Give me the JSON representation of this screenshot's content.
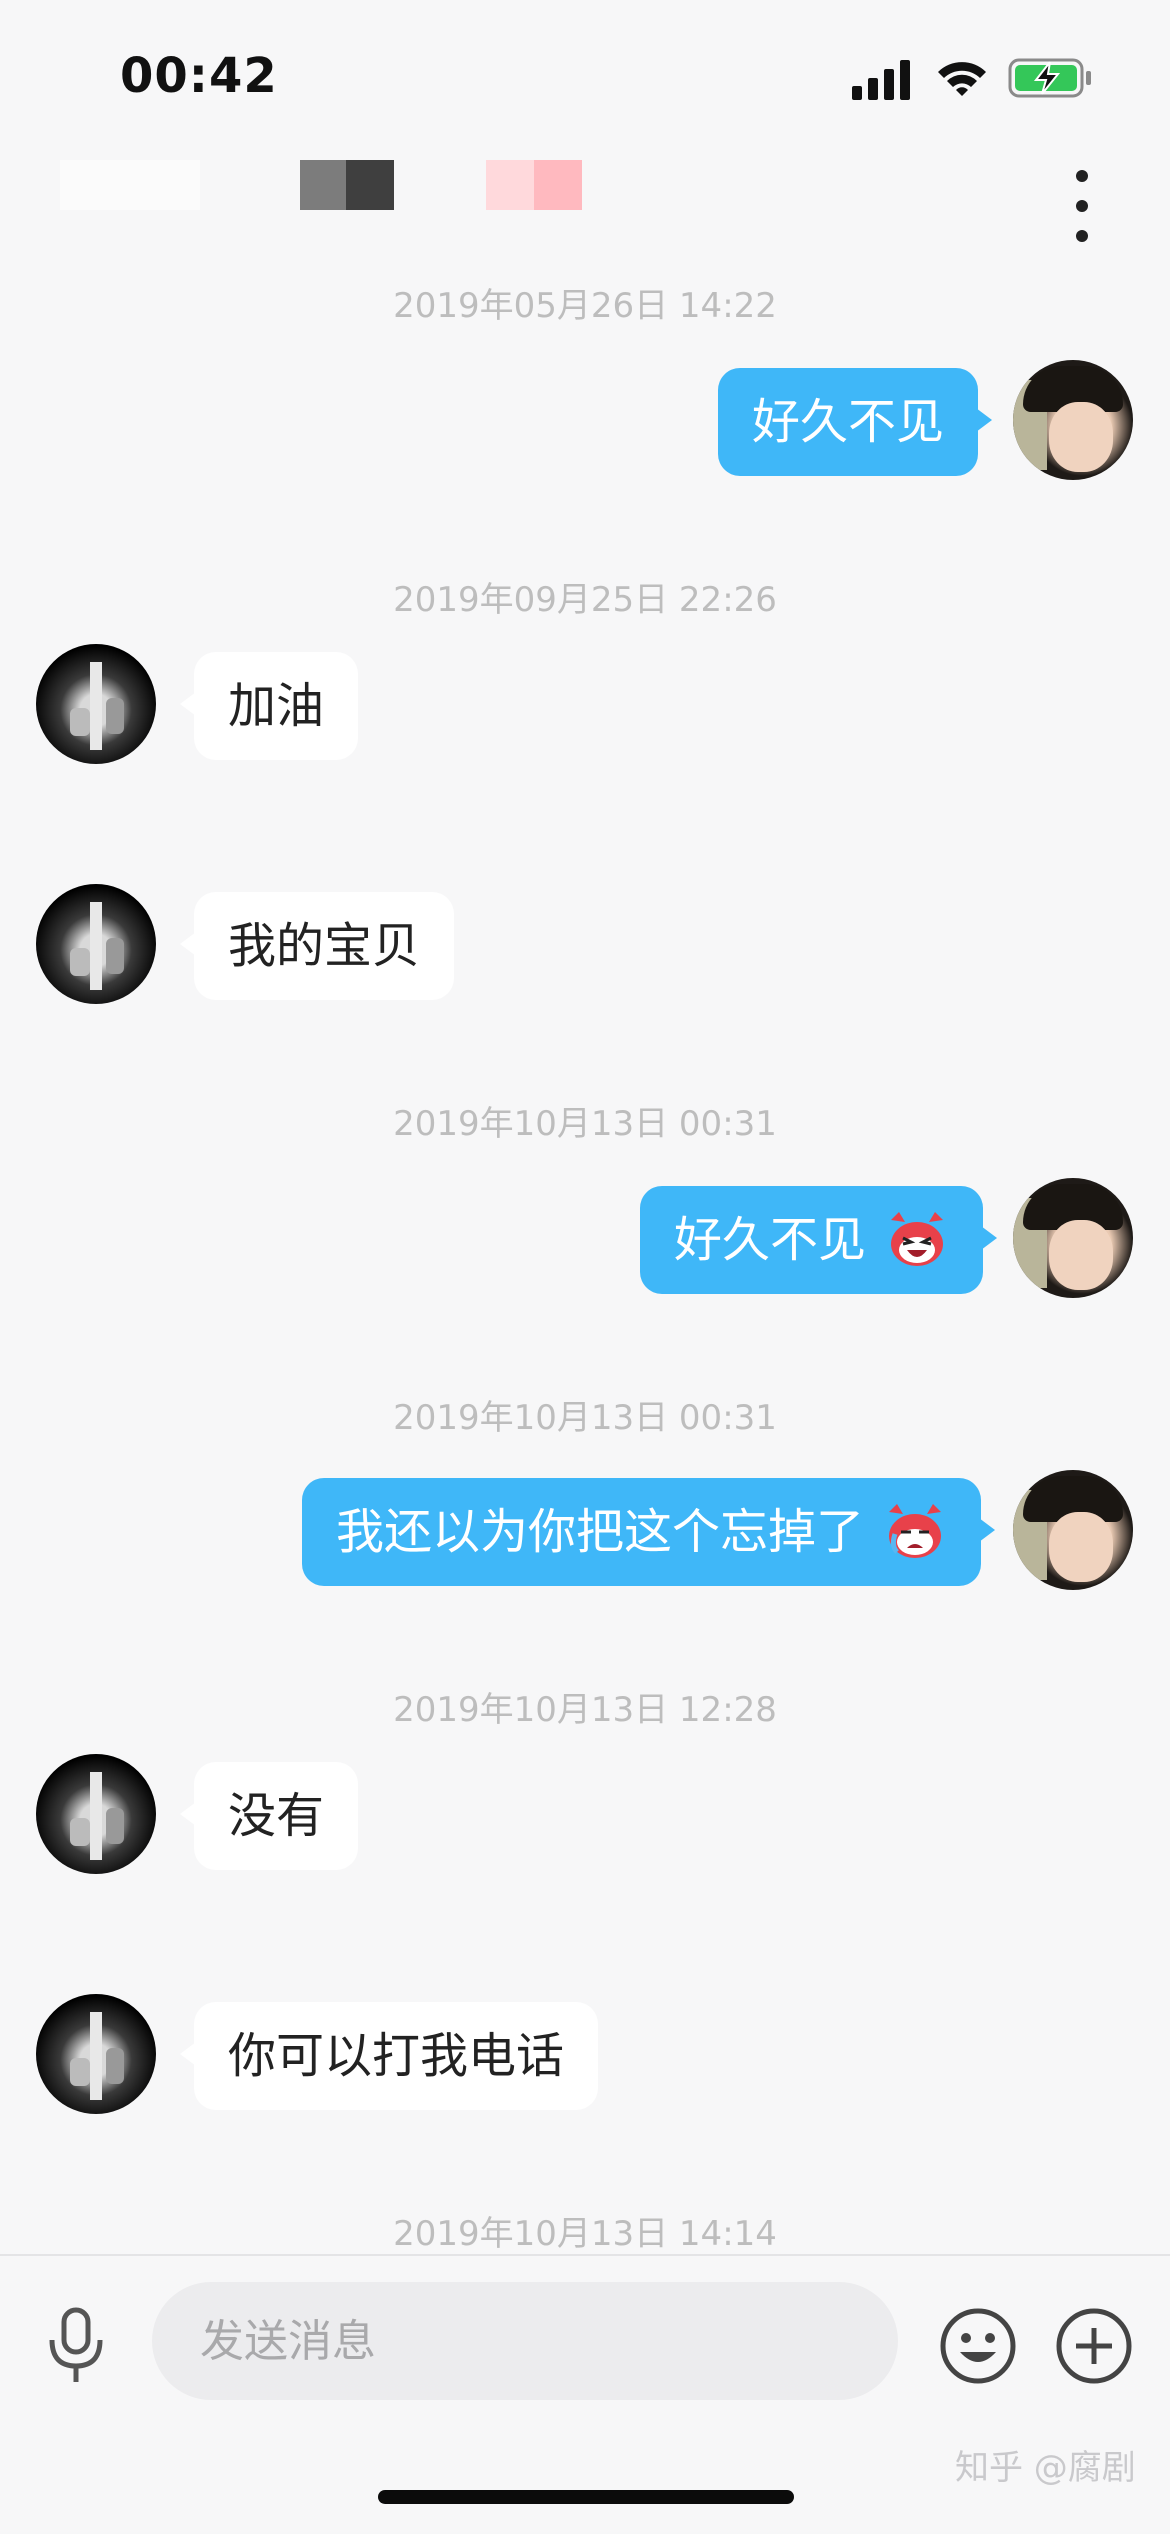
{
  "status_bar": {
    "time": "00:42"
  },
  "conversation": {
    "items": [
      {
        "type": "timestamp",
        "text": "2019年05月26日 14:22"
      },
      {
        "type": "message",
        "side": "out",
        "text": "好久不见"
      },
      {
        "type": "timestamp",
        "text": "2019年09月25日 22:26"
      },
      {
        "type": "message",
        "side": "in",
        "text": "加油"
      },
      {
        "type": "message",
        "side": "in",
        "text": "我的宝贝"
      },
      {
        "type": "timestamp",
        "text": "2019年10月13日 00:31"
      },
      {
        "type": "message",
        "side": "out",
        "text": "好久不见",
        "emoji": "laughing-crab-emoji"
      },
      {
        "type": "timestamp",
        "text": "2019年10月13日 00:31"
      },
      {
        "type": "message",
        "side": "out",
        "text": "我还以为你把这个忘掉了",
        "emoji": "crying-crab-emoji"
      },
      {
        "type": "timestamp",
        "text": "2019年10月13日 12:28"
      },
      {
        "type": "message",
        "side": "in",
        "text": "没有"
      },
      {
        "type": "message",
        "side": "in",
        "text": "你可以打我电话"
      },
      {
        "type": "timestamp",
        "text": "2019年10月13日 14:14"
      }
    ]
  },
  "input": {
    "placeholder": "发送消息"
  },
  "watermark": "知乎 @腐剧",
  "colors": {
    "outgoing_bubble": "#3fb7f8",
    "incoming_bubble": "#ffffff",
    "background": "#f7f7f8",
    "timestamp": "#bdbdbd"
  },
  "icons": [
    "signal-icon",
    "wifi-icon",
    "battery-charging-icon",
    "more-vertical-icon",
    "microphone-icon",
    "emoji-icon",
    "plus-icon"
  ]
}
